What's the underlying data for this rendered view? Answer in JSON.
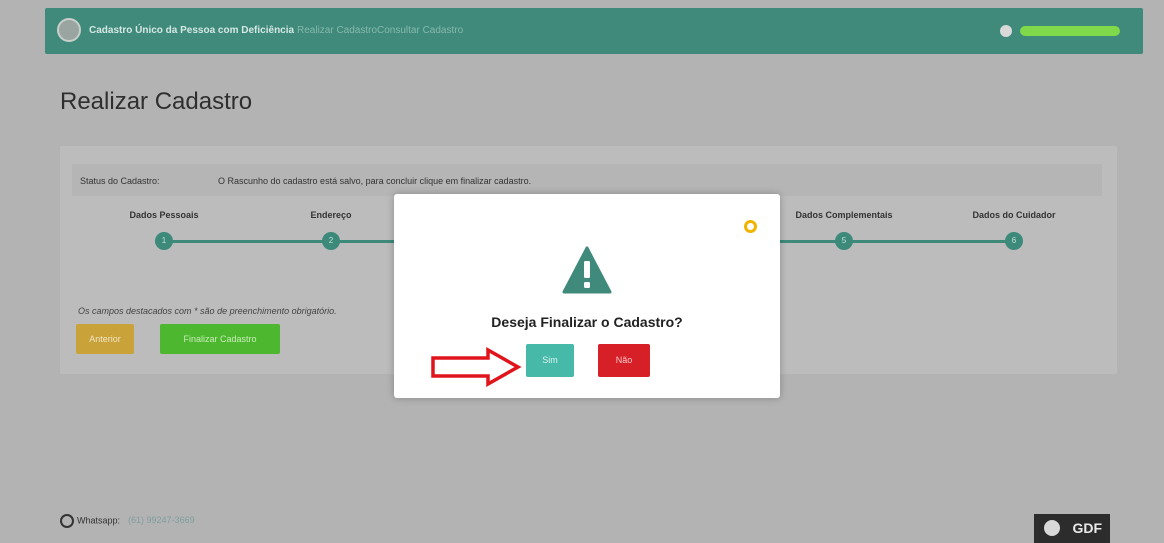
{
  "header": {
    "app_title": "Cadastro Único da Pessoa com Deficiência",
    "nav": [
      "Realizar Cadastro",
      "Consultar Cadastro"
    ]
  },
  "page": {
    "title": "Realizar Cadastro"
  },
  "status": {
    "label": "Status do Cadastro:",
    "text": "O Rascunho do cadastro está salvo, para concluir clique em finalizar cadastro."
  },
  "steps": [
    {
      "label": "Dados Pessoais",
      "num": "1"
    },
    {
      "label": "Endereço",
      "num": "2"
    },
    {
      "label": "Dados Complementais",
      "num": "5"
    },
    {
      "label": "Dados do Cuidador",
      "num": "6"
    }
  ],
  "form": {
    "required_note": "Os campos destacados com * são de preenchimento obrigatório.",
    "prev_button": "Anterior",
    "finish_button": "Finalizar Cadastro"
  },
  "modal": {
    "message": "Deseja Finalizar o Cadastro?",
    "yes": "Sim",
    "no": "Não"
  },
  "footer": {
    "whatsapp_label": "Whatsapp:",
    "whatsapp_phone": "(61) 99247-3669",
    "logo_text": "GDF"
  },
  "colors": {
    "primary": "#3f8a7b",
    "warning": "#c9a23a",
    "success": "#4db82f",
    "danger": "#d61f26",
    "teal_button": "#46b9a8"
  }
}
